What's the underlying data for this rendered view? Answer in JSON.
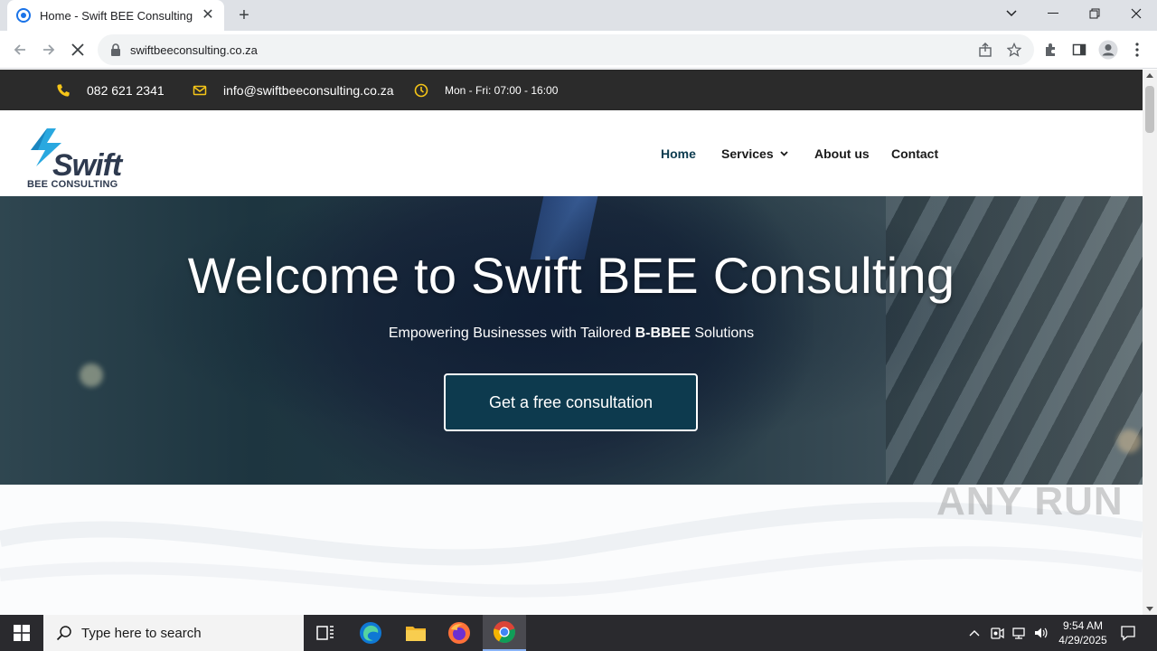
{
  "browser": {
    "tab_title": "Home - Swift BEE Consulting",
    "tab_close": "✕",
    "new_tab": "+",
    "url": "swiftbeeconsulting.co.za"
  },
  "topbar": {
    "phone": "082 621 2341",
    "email": "info@swiftbeeconsulting.co.za",
    "hours": "Mon - Fri: 07:00 - 16:00",
    "icon_color": "#f5c518"
  },
  "logo": {
    "wordmark": "Swift",
    "subtitle": "BEE CONSULTING"
  },
  "nav": {
    "items": [
      {
        "label": "Home",
        "active": true
      },
      {
        "label": "Services",
        "has_dropdown": true
      },
      {
        "label": "About us"
      },
      {
        "label": "Contact"
      }
    ]
  },
  "hero": {
    "title": "Welcome to Swift BEE Consulting",
    "subtitle_prefix": "Empowering Businesses with Tailored ",
    "subtitle_bold": "B-BBEE",
    "subtitle_suffix": " Solutions",
    "cta_label": "Get a free consultation"
  },
  "watermark": "ANY RUN",
  "taskbar": {
    "search_placeholder": "Type here to search",
    "time": "9:54 AM",
    "date": "4/29/2025"
  },
  "colors": {
    "brand_dark": "#0d3a4e",
    "topbar_bg": "#2b2b2b",
    "nav_active": "#0c3b4f"
  }
}
